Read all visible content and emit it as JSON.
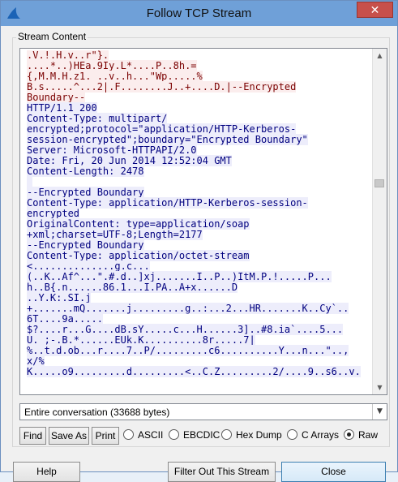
{
  "window": {
    "title": "Follow TCP Stream",
    "close_symbol": "✕"
  },
  "stream": {
    "group_label": "Stream Content",
    "lines": [
      {
        "text": ".V.!.H.v..r\"}.",
        "kind": "client"
      },
      {
        "text": "....*..)HEa.9Iy.L*....P..8h.=",
        "kind": "client"
      },
      {
        "text": "{,M.M.H.z1._..v..h...\"Wp.....%",
        "kind": "client"
      },
      {
        "text": "B.s.....^...2|.F........J..+....D.|--Encrypted",
        "kind": "client"
      },
      {
        "text": "Boundary--",
        "kind": "client"
      },
      {
        "text": "HTTP/1.1 200",
        "kind": "server"
      },
      {
        "text": "Content-Type: multipart/",
        "kind": "server"
      },
      {
        "text": "encrypted;protocol=\"application/HTTP-Kerberos-",
        "kind": "server"
      },
      {
        "text": "session-encrypted\";boundary=\"Encrypted Boundary\"",
        "kind": "server"
      },
      {
        "text": "Server: Microsoft-HTTPAPI/2.0",
        "kind": "server"
      },
      {
        "text": "Date: Fri, 20 Jun 2014 12:52:04 GMT",
        "kind": "server"
      },
      {
        "text": "Content-Length: 2478",
        "kind": "server"
      },
      {
        "text": "",
        "kind": "server"
      },
      {
        "text": "--Encrypted Boundary",
        "kind": "server"
      },
      {
        "text": "Content-Type: application/HTTP-Kerberos-session-",
        "kind": "server"
      },
      {
        "text": "encrypted",
        "kind": "server"
      },
      {
        "text": "OriginalContent: type=application/soap",
        "kind": "server"
      },
      {
        "text": "+xml;charset=UTF-8;Length=2177",
        "kind": "server"
      },
      {
        "text": "--Encrypted Boundary",
        "kind": "server"
      },
      {
        "text": "Content-Type: application/octet-stream",
        "kind": "server"
      },
      {
        "text": "<..............g.c...",
        "kind": "server"
      },
      {
        "text": "(..K..Af^...\".#.d..]xj.......I..P..)ItM.P.!.....P...",
        "kind": "server"
      },
      {
        "text": "h..B{.n......86.1...I.PA..A+x......D",
        "kind": "server"
      },
      {
        "text": "..Y.K:.SI.j",
        "kind": "server"
      },
      {
        "text": "+.......mQ.......j.........g..:...2...HR.......K..Cy`..",
        "kind": "server"
      },
      {
        "text": "6T....9a.....",
        "kind": "server"
      },
      {
        "text": "$?....r...G....dB.sY.....c...H......3]..#8.ia`....5...",
        "kind": "server"
      },
      {
        "text": "U._;-.B.*......EUk.K..........8r.....7|",
        "kind": "server"
      },
      {
        "text": "%..t.d.ob...r....7..P/.........c6..........Y...n...\"..,",
        "kind": "server"
      },
      {
        "text": "x/%",
        "kind": "server"
      },
      {
        "text": "K.....o9.........d.........<..C.Z.........2/....9..s6..v.",
        "kind": "server"
      }
    ]
  },
  "conversation_select": {
    "value": "Entire conversation (33688 bytes)"
  },
  "buttons": {
    "find": "Find",
    "save_as": "Save As",
    "print": "Print",
    "help": "Help",
    "filter_out": "Filter Out This Stream",
    "close": "Close"
  },
  "format_options": {
    "ascii": "ASCII",
    "ebcdic": "EBCDIC",
    "hex_dump": "Hex Dump",
    "c_arrays": "C Arrays",
    "raw": "Raw",
    "selected": "raw"
  },
  "colors": {
    "client_text": "#7a0000",
    "client_bg": "#fbeded",
    "server_text": "#00007f",
    "server_bg": "#ededfb"
  }
}
